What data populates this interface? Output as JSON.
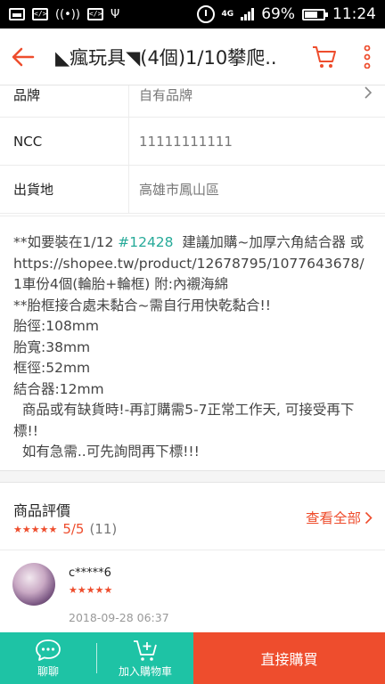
{
  "status_bar": {
    "battery": "69%",
    "time": "11:24",
    "network": "4G"
  },
  "header": {
    "title": "◣瘋玩具◥(4個)1/10攀爬..",
    "back_icon": "arrow-left-icon",
    "cart_icon": "cart-icon",
    "more_icon": "more-vertical-icon"
  },
  "specs": [
    {
      "label": "品牌",
      "value": "自有品牌"
    },
    {
      "label": "NCC",
      "value": "11111111111"
    },
    {
      "label": "出貨地",
      "value": "高雄市鳳山區"
    }
  ],
  "description": {
    "line1_before": "**如要裝在1/12 ",
    "hashtag": "#12428",
    "line1_after": "  建議加購~加厚六角結合器 或https://shopee.tw/product/12678795/1077643678/1車份4個(輪胎+輪框) 附:內襯海綿",
    "rest": "**胎框接合處未黏合~需自行用快乾黏合!!\n胎徑:108mm\n胎寬:38mm\n框徑:52mm\n結合器:12mm\n  商品或有缺貨時!-再訂購需5-7正常工作天, 可接受再下標!!\n  如有急需..可先詢問再下標!!!"
  },
  "ratings": {
    "title": "商品評價",
    "stars": "★★★★★",
    "score": "5/5",
    "count": "(11)",
    "view_all": "查看全部"
  },
  "review": {
    "username": "c*****6",
    "stars": "★★★★★",
    "date": "2018-09-28 06:37"
  },
  "bottom_bar": {
    "chat_label": "聊聊",
    "add_cart_label": "加入購物車",
    "buy_now_label": "直接購買"
  },
  "colors": {
    "accent": "#ee4d2d",
    "teal": "#1ec3a5",
    "hashtag": "#26aa99"
  }
}
